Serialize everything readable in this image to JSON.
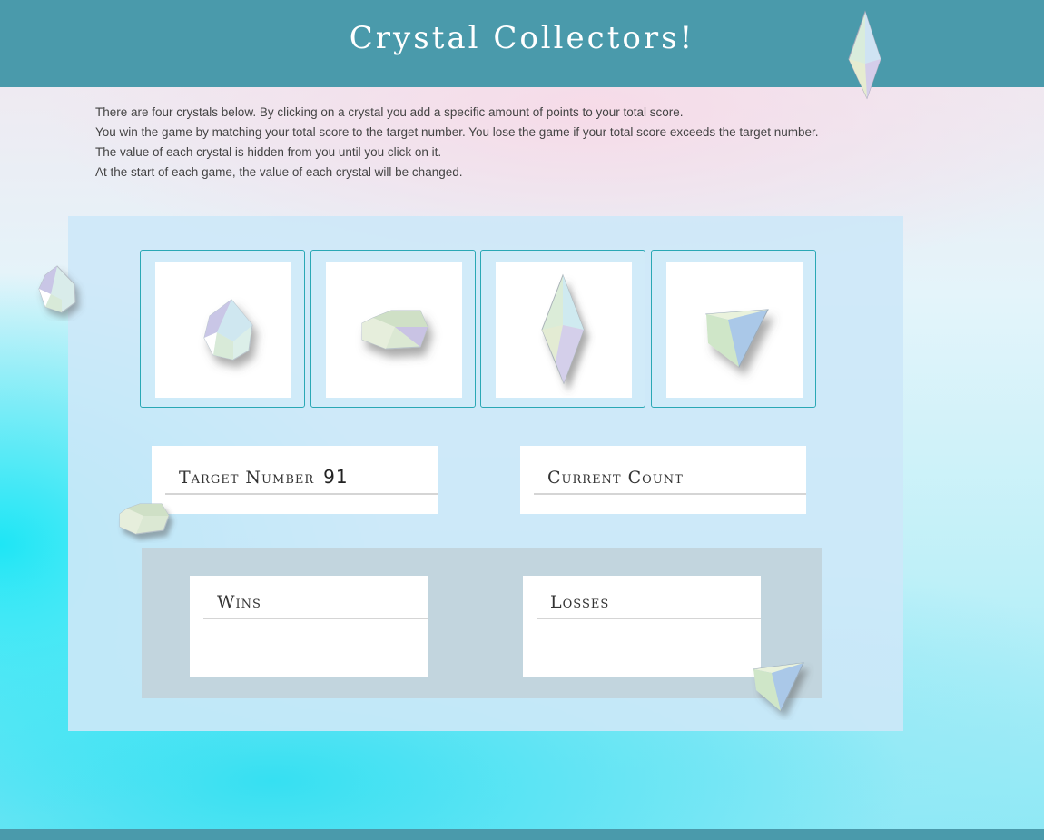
{
  "header": {
    "title": "Crystal Collectors!"
  },
  "intro": {
    "lines": [
      "There are four crystals below. By clicking on a crystal you add a specific amount of points to your total score.",
      "You win the game by matching your total score to the target number. You lose the game if your total score exceeds the target number.",
      "The value of each crystal is hidden from you until you click on it.",
      "At the start of each game, the value of each crystal will be changed."
    ]
  },
  "crystals": [
    {
      "icon": "round-crystal-icon"
    },
    {
      "icon": "flat-crystal-icon"
    },
    {
      "icon": "tall-crystal-icon"
    },
    {
      "icon": "pyramid-crystal-icon"
    }
  ],
  "stats": {
    "target_label": "Target Number",
    "target_value": "91",
    "current_label": "Current Count",
    "current_value": "",
    "wins_label": "Wins",
    "wins_value": "",
    "losses_label": "Losses",
    "losses_value": ""
  },
  "colors": {
    "header": "#4a9aab",
    "card_border": "#2aa8b5",
    "panel": "#cde8f8",
    "scores_panel": "#c2d5de"
  }
}
